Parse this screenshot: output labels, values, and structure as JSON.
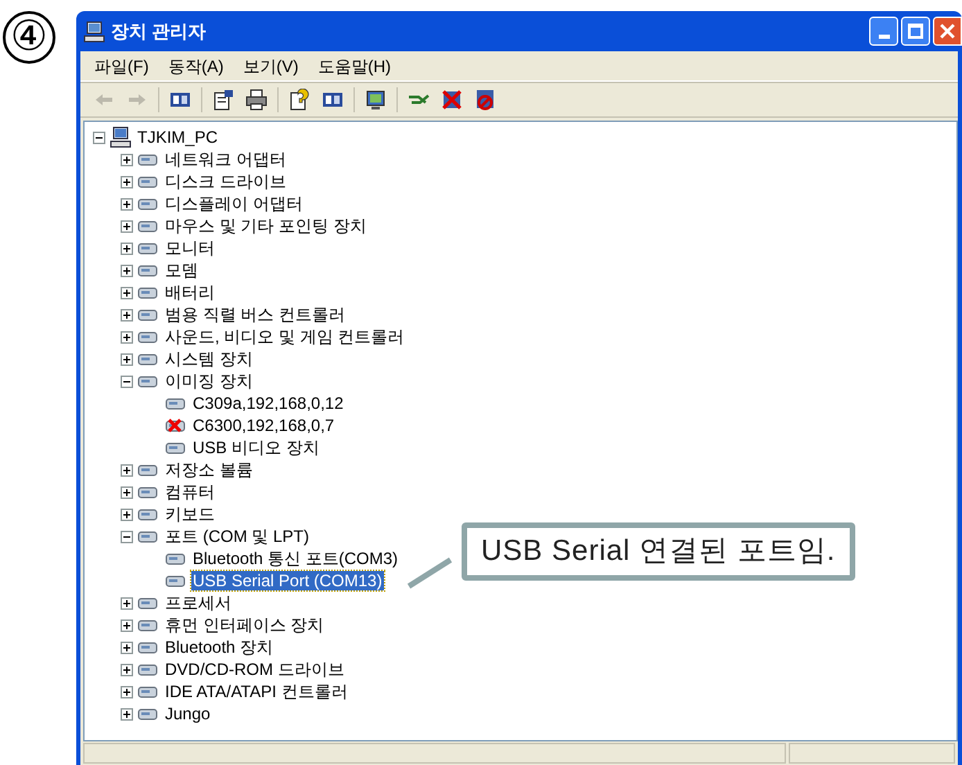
{
  "step_marker": "④",
  "window": {
    "title": "장치 관리자"
  },
  "menu": [
    "파일(F)",
    "동작(A)",
    "보기(V)",
    "도움말(H)"
  ],
  "toolbar": [
    {
      "kind": "back",
      "disabled": true
    },
    {
      "kind": "forward",
      "disabled": true
    },
    {
      "kind": "panel",
      "disabled": false
    },
    {
      "kind": "properties",
      "disabled": false
    },
    {
      "kind": "print",
      "disabled": false
    },
    {
      "kind": "help",
      "disabled": false
    },
    {
      "kind": "panel",
      "disabled": false
    },
    {
      "kind": "scan",
      "disabled": false
    },
    {
      "kind": "update",
      "disabled": false
    },
    {
      "kind": "remove",
      "disabled": false
    },
    {
      "kind": "disable",
      "disabled": false
    }
  ],
  "tree": [
    {
      "label": "TJKIM_PC",
      "expanded": true,
      "selected": false,
      "children": [
        {
          "label": "네트워크 어댑터",
          "expanded": false,
          "selected": false
        },
        {
          "label": "디스크 드라이브",
          "expanded": false,
          "selected": false
        },
        {
          "label": "디스플레이 어댑터",
          "expanded": false,
          "selected": false
        },
        {
          "label": "마우스 및 기타 포인팅 장치",
          "expanded": false,
          "selected": false
        },
        {
          "label": "모니터",
          "expanded": false,
          "selected": false
        },
        {
          "label": "모뎀",
          "expanded": false,
          "selected": false
        },
        {
          "label": "배터리",
          "expanded": false,
          "selected": false
        },
        {
          "label": "범용 직렬 버스 컨트롤러",
          "expanded": false,
          "selected": false
        },
        {
          "label": "사운드, 비디오 및 게임 컨트롤러",
          "expanded": false,
          "selected": false
        },
        {
          "label": "시스템 장치",
          "expanded": false,
          "selected": false
        },
        {
          "label": "이미징 장치",
          "expanded": true,
          "selected": false,
          "children": [
            {
              "label": "C309a,192,168,0,12",
              "selected": false,
              "error": false
            },
            {
              "label": "C6300,192,168,0,7",
              "selected": false,
              "error": true
            },
            {
              "label": "USB 비디오 장치",
              "selected": false,
              "error": false
            }
          ]
        },
        {
          "label": "저장소 볼륨",
          "expanded": false,
          "selected": false
        },
        {
          "label": "컴퓨터",
          "expanded": false,
          "selected": false
        },
        {
          "label": "키보드",
          "expanded": false,
          "selected": false
        },
        {
          "label": "포트 (COM 및 LPT)",
          "expanded": true,
          "selected": false,
          "children": [
            {
              "label": "Bluetooth 통신 포트(COM3)",
              "selected": false,
              "error": false
            },
            {
              "label": "USB Serial Port (COM13)",
              "selected": true,
              "error": false
            }
          ]
        },
        {
          "label": "프로세서",
          "expanded": false,
          "selected": false
        },
        {
          "label": "휴먼 인터페이스 장치",
          "expanded": false,
          "selected": false
        },
        {
          "label": "Bluetooth 장치",
          "expanded": false,
          "selected": false
        },
        {
          "label": "DVD/CD-ROM 드라이브",
          "expanded": false,
          "selected": false
        },
        {
          "label": "IDE ATA/ATAPI 컨트롤러",
          "expanded": false,
          "selected": false
        },
        {
          "label": "Jungo",
          "expanded": false,
          "selected": false
        }
      ]
    }
  ],
  "callout": "USB Serial 연결된 포트임."
}
